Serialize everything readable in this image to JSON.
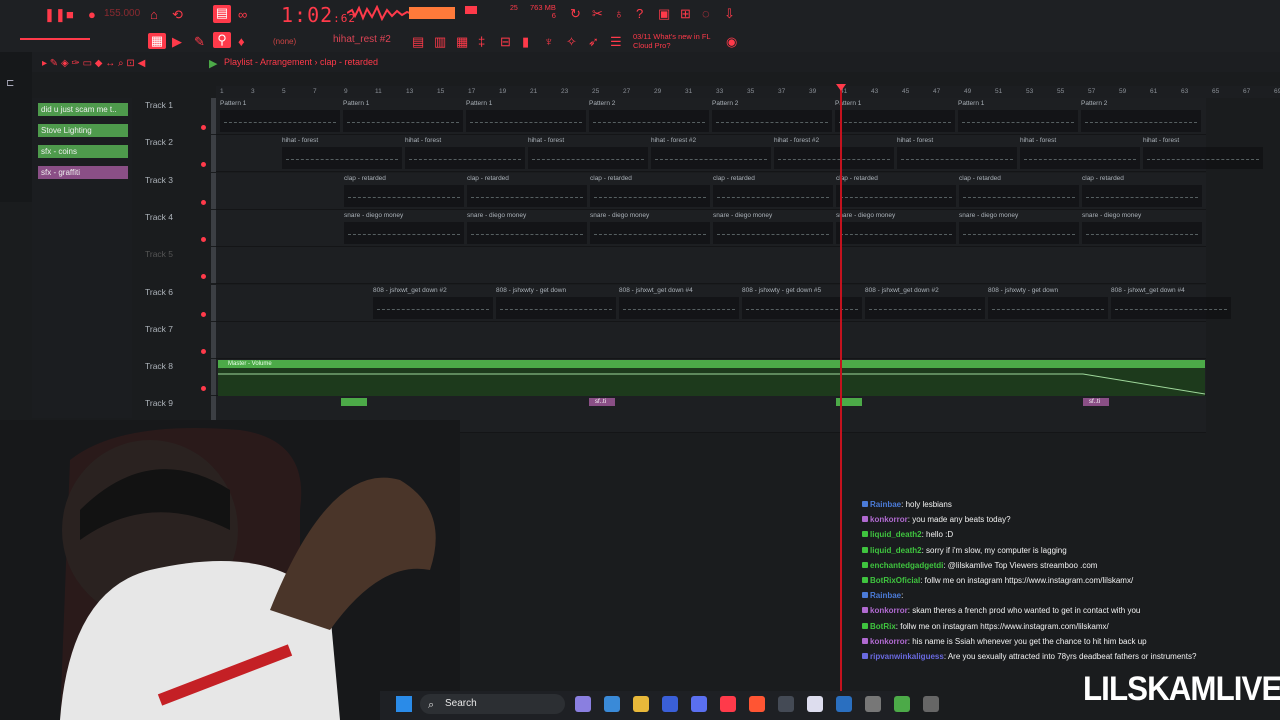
{
  "colors": {
    "accent": "#ff3a4a",
    "clip_green": "#4caa48",
    "playhead": "#c4121e",
    "panel": "#1d1f22"
  },
  "toolbar": {
    "tempo": "155.000",
    "time": "1:02",
    "time_frac": ":62",
    "memory_top": "763 MB",
    "memory_bottom": "6",
    "meter_a": "25",
    "meter_b": "6",
    "pattern": "hihat_rest #2",
    "snap": "(none)",
    "news_line1": "03/11  What's new in FL",
    "news_line2": "Cloud Pro?"
  },
  "playlist": {
    "breadcrumb": "Playlist - Arrangement  ›  clap - retarded"
  },
  "picker": {
    "items": [
      {
        "label": "did u just scam me t..",
        "color": "#4e9a4c"
      },
      {
        "label": "Stove Lighting",
        "color": "#4e9a4c"
      },
      {
        "label": "sfx - coins",
        "color": "#4e9a4c"
      },
      {
        "label": "sfx - graffiti",
        "color": "#8a4f86"
      }
    ]
  },
  "ruler": [
    "1",
    "3",
    "5",
    "7",
    "9",
    "11",
    "13",
    "15",
    "17",
    "19",
    "21",
    "23",
    "25",
    "27",
    "29",
    "31",
    "33",
    "35",
    "37",
    "39",
    "41",
    "43",
    "45",
    "47",
    "49",
    "51",
    "53",
    "55",
    "57",
    "59",
    "61",
    "63",
    "65",
    "67",
    "69"
  ],
  "tracks": [
    "Track 1",
    "Track 2",
    "Track 3",
    "Track 4",
    "Track 5",
    "Track 6",
    "Track 7",
    "Track 8",
    "Track 9"
  ],
  "clips": {
    "track1": [
      "Pattern 1",
      "Pattern 1",
      "Pattern 1",
      "Pattern 2",
      "Pattern 2",
      "Pattern 1",
      "Pattern 1",
      "Pattern 2"
    ],
    "track2": [
      "hihat - forest",
      "hihat - forest",
      "hihat - forest",
      "hihat - forest #2",
      "hihat - forest #2",
      "hihat - forest",
      "hihat - forest",
      "hihat - forest"
    ],
    "track3": [
      "clap - retarded",
      "clap - retarded",
      "clap - retarded",
      "clap - retarded",
      "clap - retarded",
      "clap - retarded",
      "clap - retarded"
    ],
    "track4": [
      "snare - diego money",
      "snare - diego money",
      "snare - diego money",
      "snare - diego money",
      "snare - diego money",
      "snare - diego money",
      "snare - diego money"
    ],
    "track6": [
      "808 - jshxwt_get down #2",
      "808 - jshxwty - get down",
      "808 - jshxwt_get down #4",
      "808 - jshxwty - get down #5",
      "808 - jshxwt_get down #2",
      "808 - jshxwty - get down",
      "808 - jshxwt_get down #4"
    ],
    "automation": "Master - Volume",
    "track9": [
      "sf..ti",
      "sf..ti"
    ]
  },
  "chat": [
    {
      "user": "Rainbae",
      "msg": ": holy lesbians",
      "color": "#4b7bd8"
    },
    {
      "user": "konkorror",
      "msg": ": you made any beats today?",
      "color": "#b06ad0"
    },
    {
      "user": "liquid_death2",
      "msg": ": hello :D",
      "color": "#3fc43f"
    },
    {
      "user": "liquid_death2",
      "msg": ": sorry if i'm slow, my computer is lagging",
      "color": "#3fc43f"
    },
    {
      "user": "enchantedgadgetdi",
      "msg": ": @lilskamlive Top Viewers streamboo .com",
      "color": "#3fc43f"
    },
    {
      "user": "BotRixOficial",
      "msg": ": follw me on instagram https://www.instagram.com/lilskamx/",
      "color": "#3fc43f"
    },
    {
      "user": "Rainbae",
      "msg": ":",
      "color": "#4b7bd8"
    },
    {
      "user": "konkorror",
      "msg": ": skam theres a french prod who wanted to get in contact with you",
      "color": "#b06ad0"
    },
    {
      "user": "BotRix",
      "msg": ": follw me on instagram https://www.instagram.com/lilskamx/",
      "color": "#3fc43f"
    },
    {
      "user": "konkorror",
      "msg": ": his name is Ssiah whenever you get the chance to hit him back up",
      "color": "#b06ad0"
    },
    {
      "user": "ripvanwinkaliguess",
      "msg": ": Are you sexually attracted into 78yrs deadbeat fathers or instruments?",
      "color": "#6a6ae0"
    }
  ],
  "taskbar": {
    "search": "Search"
  },
  "watermark": "LILSKAMLIVE"
}
